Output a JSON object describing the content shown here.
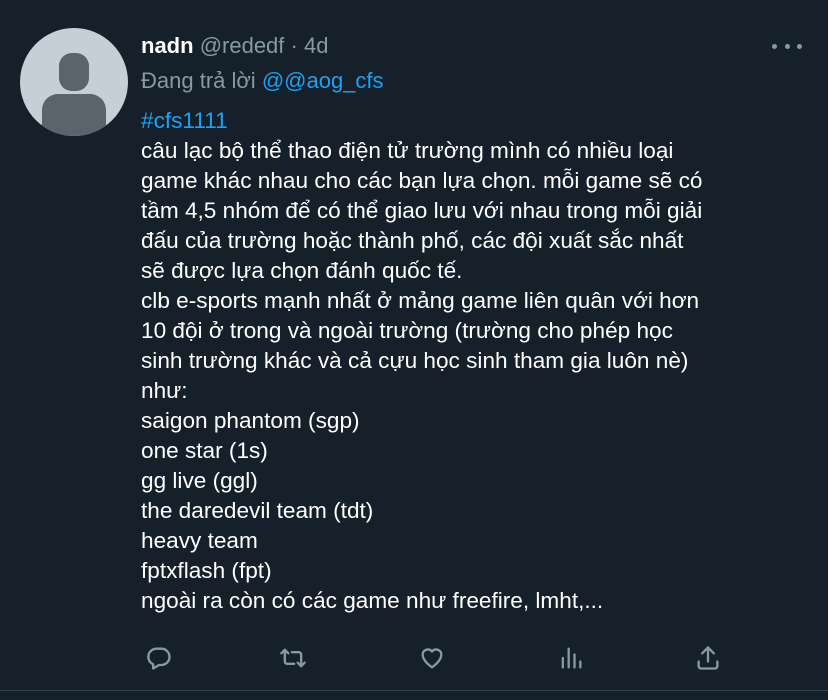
{
  "tweet": {
    "display_name": "nadn",
    "handle": "@rededf",
    "separator": "·",
    "time": "4d",
    "reply_prefix": "Đang trả lời",
    "reply_to": "@@aog_cfs",
    "hashtag": "#cfs1111",
    "lines": [
      "câu lạc bộ thể thao điện tử trường mình có nhiều loại",
      "game khác nhau cho các bạn lựa chọn. mỗi game sẽ có",
      "tầm 4,5 nhóm để có thể giao lưu với nhau trong mỗi giải",
      "đấu của trường hoặc thành phố, các đội xuất sắc nhất",
      "sẽ được lựa chọn đánh quốc tế.",
      "clb e-sports mạnh nhất ở mảng game liên quân với hơn",
      "10 đội ở trong và ngoài trường (trường cho phép học",
      "sinh trường khác và cả cựu học sinh tham gia luôn nè)",
      "như:",
      "saigon phantom (sgp)",
      "one star (1s)",
      "gg live (ggl)",
      "the daredevil team (tdt)",
      "heavy team",
      "fptxflash (fpt)",
      "ngoài ra còn có các game như freefire, lmht,..."
    ]
  },
  "actions": [
    {
      "name": "reply-icon"
    },
    {
      "name": "retweet-icon"
    },
    {
      "name": "like-icon"
    },
    {
      "name": "analytics-icon"
    },
    {
      "name": "share-icon"
    }
  ],
  "colors": {
    "background": "#15202b",
    "accent": "#1da1f2",
    "muted": "#8899a6"
  }
}
